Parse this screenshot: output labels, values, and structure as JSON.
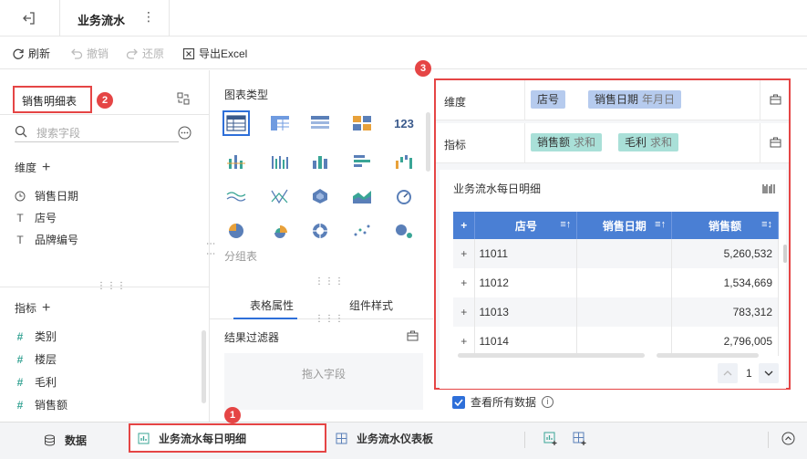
{
  "topbar": {
    "title": "业务流水",
    "more": "⋮"
  },
  "toolbar": {
    "refresh": "刷新",
    "undo": "撤销",
    "redo": "还原",
    "export": "导出Excel"
  },
  "left": {
    "dataset": "销售明细表",
    "marker": "2",
    "search_placeholder": "搜索字段",
    "dimensions_title": "维度",
    "dimensions": [
      {
        "label": "销售日期",
        "icon": "clock-icon"
      },
      {
        "label": "店号",
        "icon": "text-type-icon"
      },
      {
        "label": "品牌编号",
        "icon": "text-type-icon"
      }
    ],
    "measures_title": "指标",
    "measures": [
      {
        "label": "类别"
      },
      {
        "label": "楼层"
      },
      {
        "label": "毛利"
      },
      {
        "label": "销售额"
      }
    ]
  },
  "middle": {
    "chart_type_title": "图表类型",
    "more_label": "分组表",
    "tab_table": "表格属性",
    "tab_component": "组件样式",
    "filter_title": "结果过滤器",
    "drop_placeholder": "拖入字段"
  },
  "right": {
    "marker": "3",
    "dimension_label": "维度",
    "dimension_pills": [
      {
        "name": "店号",
        "agg": ""
      },
      {
        "name": "销售日期",
        "agg": "年月日"
      }
    ],
    "measure_label": "指标",
    "measure_pills": [
      {
        "name": "销售额",
        "agg": "求和"
      },
      {
        "name": "毛利",
        "agg": "求和"
      }
    ],
    "card_title": "业务流水每日明细",
    "table": {
      "headers": [
        "+",
        "店号",
        "销售日期",
        "销售额"
      ],
      "rows": [
        [
          "+",
          "11011",
          "",
          "5,260,532"
        ],
        [
          "+",
          "11012",
          "",
          "1,534,669"
        ],
        [
          "+",
          "11013",
          "",
          "783,312"
        ],
        [
          "+",
          "11014",
          "",
          "2,796,005"
        ]
      ]
    },
    "page": "1"
  },
  "showall": {
    "label": "查看所有数据",
    "checked": true
  },
  "bottom": {
    "data_tab": "数据",
    "marker": "1",
    "active_tab": "业务流水每日明细",
    "dashboard_tab": "业务流水仪表板"
  },
  "colors": {
    "accent": "#2e6fd9",
    "header": "#4a7fd4",
    "highlight": "#e54545",
    "dim_pill": "#b6cbee",
    "measure_pill": "#a9e0d8"
  }
}
